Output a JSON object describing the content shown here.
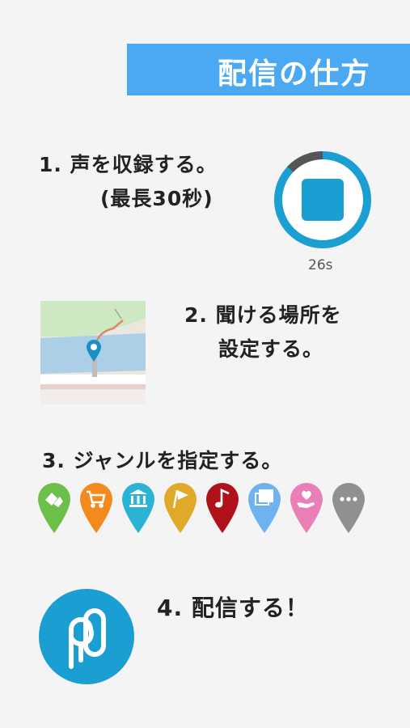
{
  "header": {
    "title": "配信の仕方"
  },
  "steps": [
    {
      "line1": "1. 声を収録する。",
      "line2": "(最長30秒)"
    },
    {
      "line1": "2. 聞ける場所を",
      "line2": "設定する。"
    },
    {
      "line1": "3. ジャンルを指定する。"
    },
    {
      "line1": "4.  配信する！"
    }
  ],
  "recorder": {
    "elapsed_label": "26s",
    "progress": 0.87
  },
  "genres": [
    {
      "icon": "handshake-icon",
      "color": "#6cc04a"
    },
    {
      "icon": "shopping-cart-icon",
      "color": "#f28a1e"
    },
    {
      "icon": "museum-icon",
      "color": "#2bb3d6"
    },
    {
      "icon": "flag-icon",
      "color": "#e0a92a"
    },
    {
      "icon": "music-note-icon",
      "color": "#b0121b"
    },
    {
      "icon": "photos-icon",
      "color": "#6fb2f0"
    },
    {
      "icon": "heart-hand-icon",
      "color": "#ea7fb7"
    },
    {
      "icon": "more-icon",
      "color": "#909090"
    }
  ],
  "colors": {
    "banner": "#4aa9f2",
    "accent": "#1b9fd3"
  }
}
